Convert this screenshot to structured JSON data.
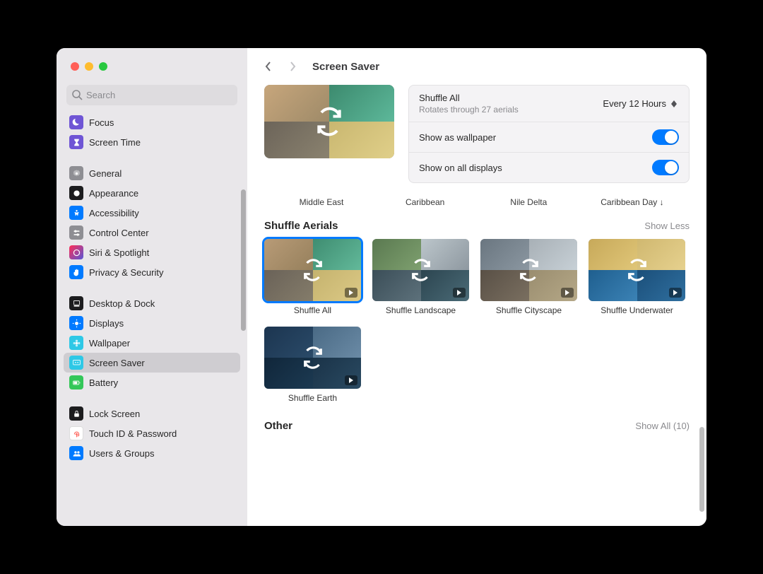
{
  "search": {
    "placeholder": "Search"
  },
  "page": {
    "title": "Screen Saver"
  },
  "sidebar": {
    "g0": [
      {
        "label": "Focus"
      },
      {
        "label": "Screen Time"
      }
    ],
    "g1": [
      {
        "label": "General"
      },
      {
        "label": "Appearance"
      },
      {
        "label": "Accessibility"
      },
      {
        "label": "Control Center"
      },
      {
        "label": "Siri & Spotlight"
      },
      {
        "label": "Privacy & Security"
      }
    ],
    "g2": [
      {
        "label": "Desktop & Dock"
      },
      {
        "label": "Displays"
      },
      {
        "label": "Wallpaper"
      },
      {
        "label": "Screen Saver"
      },
      {
        "label": "Battery"
      }
    ],
    "g3": [
      {
        "label": "Lock Screen"
      },
      {
        "label": "Touch ID & Password"
      },
      {
        "label": "Users & Groups"
      }
    ]
  },
  "detail": {
    "name": "Shuffle All",
    "sub": "Rotates through 27 aerials",
    "interval": "Every 12 Hours",
    "showWallpaper": "Show as wallpaper",
    "showAllDisplays": "Show on all displays"
  },
  "peek": {
    "a": "Middle East",
    "b": "Caribbean",
    "c": "Nile Delta",
    "d": "Caribbean Day ↓"
  },
  "sections": {
    "aerials": {
      "title": "Shuffle Aerials",
      "action": "Show Less",
      "items": [
        {
          "label": "Shuffle All"
        },
        {
          "label": "Shuffle Landscape"
        },
        {
          "label": "Shuffle Cityscape"
        },
        {
          "label": "Shuffle Underwater"
        },
        {
          "label": "Shuffle Earth"
        }
      ]
    },
    "other": {
      "title": "Other",
      "action": "Show All (10)"
    }
  }
}
